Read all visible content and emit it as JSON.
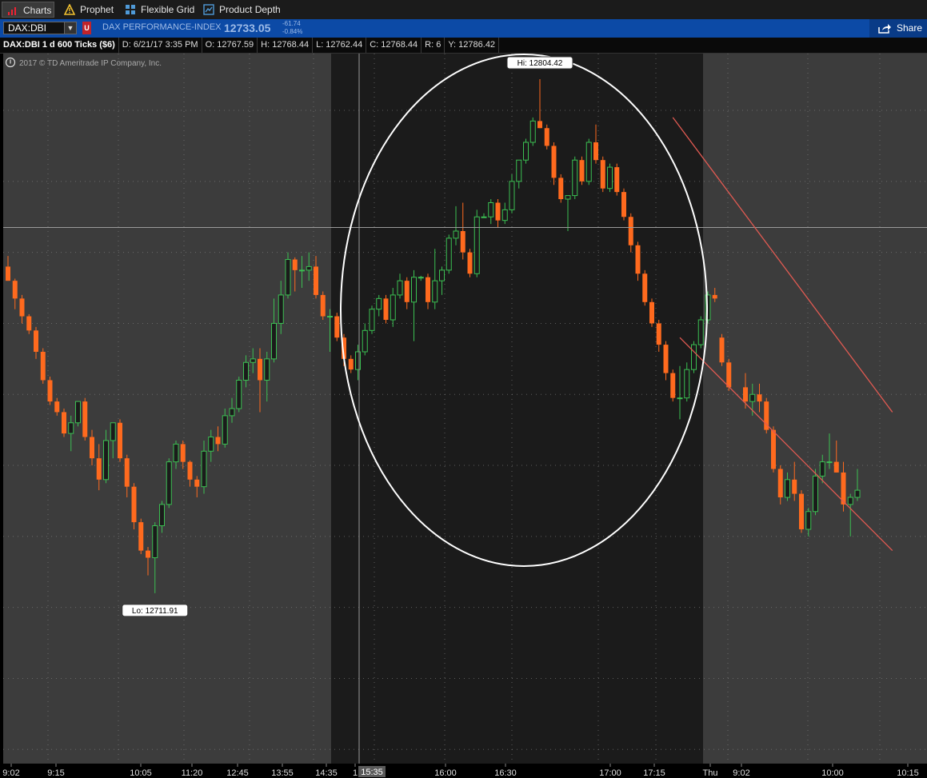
{
  "tabs": [
    {
      "label": "Charts",
      "icon": "bar-chart-icon"
    },
    {
      "label": "Prophet",
      "icon": "warning-triangle-icon"
    },
    {
      "label": "Flexible Grid",
      "icon": "grid-icon"
    },
    {
      "label": "Product Depth",
      "icon": "depth-chart-icon"
    }
  ],
  "symbol": {
    "value": "DAX:DBI",
    "name": "DAX PERFORMANCE-INDEX",
    "price": "12733.05",
    "change": "-61.74",
    "change_pct": "-0.84%",
    "share_label": "Share"
  },
  "info": {
    "title": "DAX:DBI 1 d 600 Ticks ($6)",
    "date": "D: 6/21/17 3:35 PM",
    "open": "O: 12767.59",
    "high": "H: 12768.44",
    "low": "L: 12762.44",
    "close": "C: 12768.44",
    "range": "R: 6",
    "yclose": "Y: 12786.42"
  },
  "copyright": "2017 © TD Ameritrade IP Company, Inc.",
  "colors": {
    "up": "#3bbf52",
    "down": "#ff6a1e",
    "session_bg": "#3c3c3c",
    "highlight_bg": "#1b1b1b",
    "trendline": "#e05a52"
  },
  "chart_data": {
    "type": "candlestick",
    "high_label": "Hi: 12804.42",
    "low_label": "Lo: 12711.91",
    "crosshair_label": "15:35",
    "x_tick_labels": [
      "9:02",
      "9:15",
      "10:05",
      "11:20",
      "12:45",
      "13:55",
      "14:35",
      "1",
      "16:00",
      "16:30",
      "17:00",
      "17:15",
      "Thu",
      "9:02",
      "10:00",
      "10:15"
    ],
    "y_range": [
      12708,
      12808
    ],
    "candles": [
      {
        "o": 12778,
        "h": 12779.5,
        "l": 12776,
        "c": 12776
      },
      {
        "o": 12776,
        "h": 12776.3,
        "l": 12772,
        "c": 12773.5
      },
      {
        "o": 12773.5,
        "h": 12774,
        "l": 12770,
        "c": 12771
      },
      {
        "o": 12771,
        "h": 12771.3,
        "l": 12768.5,
        "c": 12769
      },
      {
        "o": 12769,
        "h": 12769.5,
        "l": 12765,
        "c": 12766
      },
      {
        "o": 12766,
        "h": 12766.5,
        "l": 12761.5,
        "c": 12762
      },
      {
        "o": 12762,
        "h": 12762.5,
        "l": 12758.5,
        "c": 12759
      },
      {
        "o": 12759,
        "h": 12759.5,
        "l": 12757,
        "c": 12757.5
      },
      {
        "o": 12757.5,
        "h": 12758,
        "l": 12754,
        "c": 12754.5
      },
      {
        "o": 12754.5,
        "h": 12757,
        "l": 12752,
        "c": 12756
      },
      {
        "o": 12756,
        "h": 12759,
        "l": 12755.5,
        "c": 12759
      },
      {
        "o": 12759,
        "h": 12759.5,
        "l": 12753.5,
        "c": 12754
      },
      {
        "o": 12754,
        "h": 12755,
        "l": 12750,
        "c": 12751
      },
      {
        "o": 12751,
        "h": 12753,
        "l": 12746.5,
        "c": 12748
      },
      {
        "o": 12748,
        "h": 12755,
        "l": 12747.5,
        "c": 12753.5
      },
      {
        "o": 12753.5,
        "h": 12756,
        "l": 12751,
        "c": 12756
      },
      {
        "o": 12756,
        "h": 12756.5,
        "l": 12750.5,
        "c": 12751
      },
      {
        "o": 12751,
        "h": 12751.5,
        "l": 12745.5,
        "c": 12747
      },
      {
        "o": 12747,
        "h": 12747.5,
        "l": 12741,
        "c": 12742
      },
      {
        "o": 12742,
        "h": 12742.5,
        "l": 12737.5,
        "c": 12738
      },
      {
        "o": 12738,
        "h": 12738.5,
        "l": 12734.5,
        "c": 12737
      },
      {
        "o": 12737,
        "h": 12742,
        "l": 12732,
        "c": 12741.5
      },
      {
        "o": 12741.5,
        "h": 12745,
        "l": 12740.5,
        "c": 12744.5
      },
      {
        "o": 12744.5,
        "h": 12751,
        "l": 12744,
        "c": 12750.5
      },
      {
        "o": 12750.5,
        "h": 12753.5,
        "l": 12749.5,
        "c": 12753
      },
      {
        "o": 12753,
        "h": 12753.5,
        "l": 12749.5,
        "c": 12750.5
      },
      {
        "o": 12750.5,
        "h": 12750.7,
        "l": 12747,
        "c": 12748
      },
      {
        "o": 12748,
        "h": 12748.5,
        "l": 12745.5,
        "c": 12747
      },
      {
        "o": 12747,
        "h": 12753.5,
        "l": 12746,
        "c": 12752
      },
      {
        "o": 12752,
        "h": 12755,
        "l": 12750.5,
        "c": 12754
      },
      {
        "o": 12754,
        "h": 12755.5,
        "l": 12752,
        "c": 12753
      },
      {
        "o": 12753,
        "h": 12758,
        "l": 12752.5,
        "c": 12757
      },
      {
        "o": 12757,
        "h": 12759.5,
        "l": 12756,
        "c": 12758
      },
      {
        "o": 12758,
        "h": 12762.5,
        "l": 12757.5,
        "c": 12762
      },
      {
        "o": 12762,
        "h": 12765.5,
        "l": 12761,
        "c": 12764.5
      },
      {
        "o": 12764.5,
        "h": 12766.5,
        "l": 12763,
        "c": 12765
      },
      {
        "o": 12765,
        "h": 12766.5,
        "l": 12757.5,
        "c": 12762
      },
      {
        "o": 12762,
        "h": 12766,
        "l": 12759,
        "c": 12765
      },
      {
        "o": 12765,
        "h": 12773.5,
        "l": 12764.5,
        "c": 12770
      },
      {
        "o": 12770,
        "h": 12776,
        "l": 12768.5,
        "c": 12774
      },
      {
        "o": 12774,
        "h": 12780,
        "l": 12773.5,
        "c": 12779
      },
      {
        "o": 12779,
        "h": 12779.3,
        "l": 12774.5,
        "c": 12777.5
      },
      {
        "o": 12777.5,
        "h": 12779.5,
        "l": 12775,
        "c": 12777.5
      },
      {
        "o": 12777.5,
        "h": 12780,
        "l": 12776,
        "c": 12778
      },
      {
        "o": 12778,
        "h": 12779.5,
        "l": 12773.5,
        "c": 12774
      },
      {
        "o": 12774,
        "h": 12774.5,
        "l": 12770.5,
        "c": 12771
      },
      {
        "o": 12771,
        "h": 12772,
        "l": 12766,
        "c": 12771
      },
      {
        "o": 12771,
        "h": 12771.5,
        "l": 12767.5,
        "c": 12768
      },
      {
        "o": 12768,
        "h": 12768.5,
        "l": 12764,
        "c": 12765
      },
      {
        "o": 12765,
        "h": 12765.5,
        "l": 12763,
        "c": 12763.5
      },
      {
        "o": 12763.5,
        "h": 12767,
        "l": 12762,
        "c": 12766
      },
      {
        "o": 12766,
        "h": 12770,
        "l": 12765.5,
        "c": 12769
      },
      {
        "o": 12769,
        "h": 12772.5,
        "l": 12768.5,
        "c": 12772
      },
      {
        "o": 12772,
        "h": 12774,
        "l": 12771,
        "c": 12773.5
      },
      {
        "o": 12773.5,
        "h": 12774,
        "l": 12770,
        "c": 12770.5
      },
      {
        "o": 12770.5,
        "h": 12775,
        "l": 12769.5,
        "c": 12774
      },
      {
        "o": 12774,
        "h": 12777,
        "l": 12773.5,
        "c": 12776
      },
      {
        "o": 12776,
        "h": 12776.5,
        "l": 12772,
        "c": 12773
      },
      {
        "o": 12773,
        "h": 12777.5,
        "l": 12767.5,
        "c": 12776.5
      },
      {
        "o": 12776.5,
        "h": 12776.7,
        "l": 12776,
        "c": 12776.5
      },
      {
        "o": 12776.5,
        "h": 12777,
        "l": 12772,
        "c": 12773
      },
      {
        "o": 12773,
        "h": 12780.5,
        "l": 12772,
        "c": 12776
      },
      {
        "o": 12776,
        "h": 12778,
        "l": 12774,
        "c": 12777.5
      },
      {
        "o": 12777.5,
        "h": 12782.5,
        "l": 12777,
        "c": 12782
      },
      {
        "o": 12782,
        "h": 12786.5,
        "l": 12781,
        "c": 12783
      },
      {
        "o": 12783,
        "h": 12787,
        "l": 12779,
        "c": 12780
      },
      {
        "o": 12780,
        "h": 12780.5,
        "l": 12776.5,
        "c": 12777
      },
      {
        "o": 12777,
        "h": 12786,
        "l": 12776.5,
        "c": 12785
      },
      {
        "o": 12785,
        "h": 12785.5,
        "l": 12785,
        "c": 12785
      },
      {
        "o": 12785,
        "h": 12787.5,
        "l": 12784,
        "c": 12787
      },
      {
        "o": 12787,
        "h": 12787.5,
        "l": 12783.5,
        "c": 12784.5
      },
      {
        "o": 12784.5,
        "h": 12787,
        "l": 12784,
        "c": 12786
      },
      {
        "o": 12786,
        "h": 12791,
        "l": 12785.5,
        "c": 12790
      },
      {
        "o": 12790,
        "h": 12793,
        "l": 12789,
        "c": 12793
      },
      {
        "o": 12793,
        "h": 12796,
        "l": 12792.5,
        "c": 12795.5
      },
      {
        "o": 12795.5,
        "h": 12799,
        "l": 12795,
        "c": 12798.5
      },
      {
        "o": 12798.5,
        "h": 12804.4,
        "l": 12797.5,
        "c": 12797.5
      },
      {
        "o": 12797.5,
        "h": 12798,
        "l": 12794.5,
        "c": 12795
      },
      {
        "o": 12795,
        "h": 12795.5,
        "l": 12789.5,
        "c": 12790.5
      },
      {
        "o": 12790.5,
        "h": 12791,
        "l": 12787,
        "c": 12787.5
      },
      {
        "o": 12787.5,
        "h": 12788,
        "l": 12783,
        "c": 12788
      },
      {
        "o": 12788,
        "h": 12793.5,
        "l": 12787.5,
        "c": 12793
      },
      {
        "o": 12793,
        "h": 12793.5,
        "l": 12789.5,
        "c": 12790
      },
      {
        "o": 12790,
        "h": 12796,
        "l": 12789.5,
        "c": 12795.5
      },
      {
        "o": 12795.5,
        "h": 12798,
        "l": 12792.5,
        "c": 12793
      },
      {
        "o": 12793,
        "h": 12793.5,
        "l": 12788.5,
        "c": 12789
      },
      {
        "o": 12789,
        "h": 12792.5,
        "l": 12788.5,
        "c": 12792
      },
      {
        "o": 12792,
        "h": 12792.5,
        "l": 12788,
        "c": 12788.5
      },
      {
        "o": 12788.5,
        "h": 12789,
        "l": 12784.5,
        "c": 12785
      },
      {
        "o": 12785,
        "h": 12785.5,
        "l": 12780,
        "c": 12781
      },
      {
        "o": 12781,
        "h": 12781.5,
        "l": 12776,
        "c": 12777
      },
      {
        "o": 12777,
        "h": 12777.5,
        "l": 12772.5,
        "c": 12773
      },
      {
        "o": 12773,
        "h": 12773.5,
        "l": 12769.5,
        "c": 12770
      },
      {
        "o": 12770,
        "h": 12770.5,
        "l": 12766,
        "c": 12767
      },
      {
        "o": 12767,
        "h": 12767.5,
        "l": 12762,
        "c": 12763
      },
      {
        "o": 12763,
        "h": 12763.5,
        "l": 12759,
        "c": 12759.5
      },
      {
        "o": 12759.5,
        "h": 12764,
        "l": 12756.5,
        "c": 12759.5
      },
      {
        "o": 12759.5,
        "h": 12764.5,
        "l": 12759,
        "c": 12763.5
      },
      {
        "o": 12763.5,
        "h": 12767.5,
        "l": 12763,
        "c": 12767
      },
      {
        "o": 12767,
        "h": 12771,
        "l": 12766.5,
        "c": 12770.5
      },
      {
        "o": 12770.5,
        "h": 12774.5,
        "l": 12770,
        "c": 12774
      },
      {
        "o": 12774,
        "h": 12775,
        "l": 12773,
        "c": 12773.5
      },
      {
        "o": 12768,
        "h": 12768.5,
        "l": 12764,
        "c": 12764.5
      },
      {
        "o": 12764.5,
        "h": 12765,
        "l": 12760.5,
        "c": 12761
      },
      {
        "o": 12761,
        "h": 12763,
        "l": 12758,
        "c": 12759
      },
      {
        "o": 12759,
        "h": 12761.5,
        "l": 12757,
        "c": 12760
      },
      {
        "o": 12760,
        "h": 12761.5,
        "l": 12757.5,
        "c": 12759
      },
      {
        "o": 12759,
        "h": 12759.5,
        "l": 12754.5,
        "c": 12755
      },
      {
        "o": 12755,
        "h": 12755.5,
        "l": 12749,
        "c": 12749.5
      },
      {
        "o": 12749.5,
        "h": 12750,
        "l": 12744.5,
        "c": 12745.5
      },
      {
        "o": 12745.5,
        "h": 12749,
        "l": 12745,
        "c": 12748
      },
      {
        "o": 12748,
        "h": 12750.5,
        "l": 12745,
        "c": 12746
      },
      {
        "o": 12746,
        "h": 12746.5,
        "l": 12740.5,
        "c": 12741
      },
      {
        "o": 12741,
        "h": 12744,
        "l": 12740,
        "c": 12743.5
      },
      {
        "o": 12743.5,
        "h": 12749.5,
        "l": 12743,
        "c": 12748.5
      },
      {
        "o": 12748.5,
        "h": 12751.5,
        "l": 12747.5,
        "c": 12750.5
      },
      {
        "o": 12750.5,
        "h": 12754.5,
        "l": 12749.5,
        "c": 12750.5
      },
      {
        "o": 12750.5,
        "h": 12753.5,
        "l": 12749,
        "c": 12749
      },
      {
        "o": 12749,
        "h": 12750.5,
        "l": 12743.5,
        "c": 12744.5
      },
      {
        "o": 12744.5,
        "h": 12746,
        "l": 12740,
        "c": 12745.5
      },
      {
        "o": 12745.5,
        "h": 12749.5,
        "l": 12745,
        "c": 12746.5
      }
    ],
    "trendlines": [
      {
        "from": [
          95,
          12799
        ],
        "to": [
          125,
          12757.5
        ]
      },
      {
        "from": [
          96,
          12768
        ],
        "to": [
          125,
          12738
        ]
      }
    ],
    "horizontal_line": 12783.5
  }
}
